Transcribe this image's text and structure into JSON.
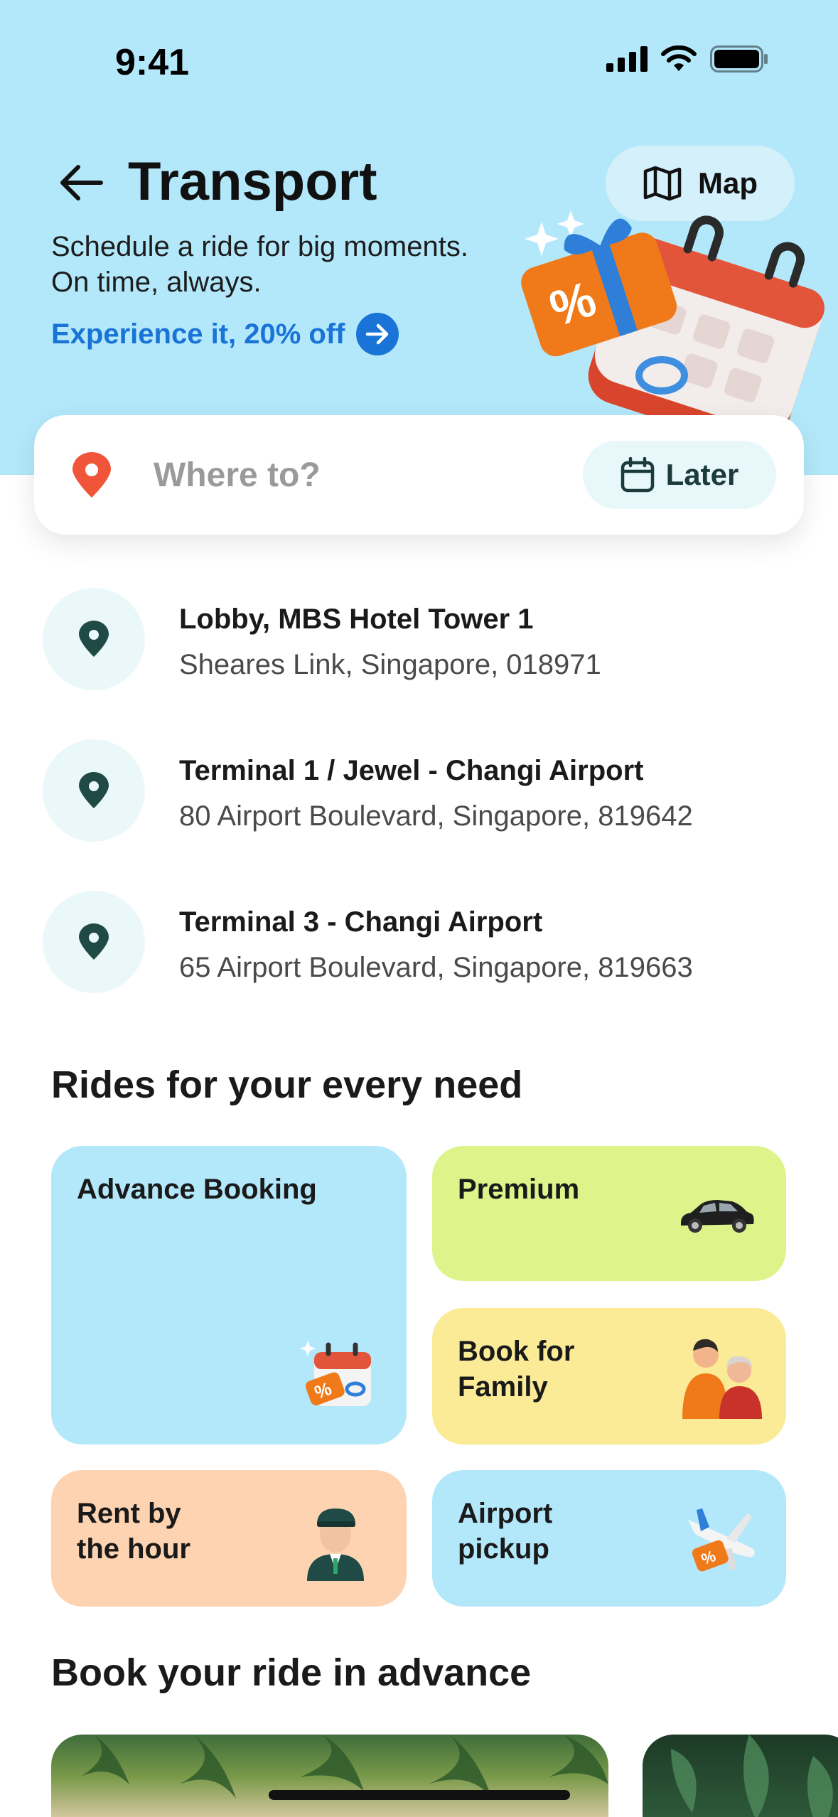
{
  "status_bar": {
    "time": "9:41"
  },
  "header": {
    "title": "Transport",
    "map_label": "Map",
    "subtitle": "Schedule a ride for big moments. On time, always.",
    "promo_link": "Experience it, 20% off"
  },
  "search": {
    "placeholder": "Where to?",
    "later_label": "Later"
  },
  "recent_places": [
    {
      "title": "Lobby, MBS Hotel Tower 1",
      "address": "Sheares Link, Singapore, 018971"
    },
    {
      "title": "Terminal 1 / Jewel - Changi Airport",
      "address": "80 Airport Boulevard, Singapore, 819642"
    },
    {
      "title": "Terminal 3 - Changi Airport",
      "address": "65 Airport Boulevard, Singapore, 819663"
    }
  ],
  "rides_section": {
    "title": "Rides for your every need",
    "tiles": [
      {
        "label": "Advance Booking",
        "color": "#b3e8fb"
      },
      {
        "label": "Premium",
        "color": "#def48a"
      },
      {
        "label_line1": "Book for",
        "label_line2": "Family",
        "color": "#fbeb96"
      },
      {
        "label_line1": "Rent by",
        "label_line2": "the hour",
        "color": "#fdd3b1"
      },
      {
        "label_line1": "Airport",
        "label_line2": "pickup",
        "color": "#b3e8fb"
      }
    ]
  },
  "advance_section": {
    "title": "Book your ride in advance"
  },
  "colors": {
    "hero_bg": "#b3e8fb",
    "link_blue": "#1a73d6",
    "pin_orange": "#f0553a",
    "pin_dark": "#1f4a46"
  }
}
